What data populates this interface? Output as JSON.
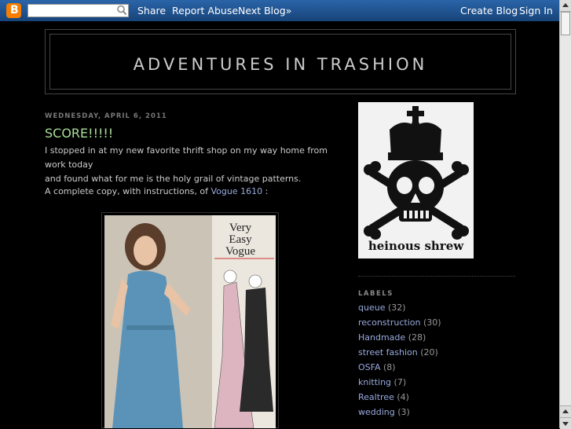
{
  "navbar": {
    "logo_letter": "B",
    "search_placeholder": "",
    "share": "Share",
    "report_abuse": "Report Abuse",
    "next_blog": "Next Blog»",
    "create_blog": "Create Blog",
    "sign_in": "Sign In",
    "bg_color": "#1f5795"
  },
  "header": {
    "title": "ADVENTURES IN TRASHION"
  },
  "post": {
    "date": "WEDNESDAY, APRIL 6, 2011",
    "title": "SCORE!!!!!",
    "paragraph_1_line_1": "I stopped in at my new favorite thrift shop on my way home from work today",
    "paragraph_1_line_2": "and found what for me is the holy grail of vintage patterns.",
    "paragraph_2_prefix": "A complete copy, with instructions, of ",
    "paragraph_2_link": "Vogue 1610",
    "paragraph_2_suffix": " :",
    "pattern_brand_line1": "Very",
    "pattern_brand_line2": "Easy",
    "pattern_brand_line3": "Vogue"
  },
  "sidebar": {
    "profile_caption": "heinous shrew",
    "labels_heading": "LABELS",
    "labels": [
      {
        "name": "queue",
        "count": "(32)"
      },
      {
        "name": "reconstruction",
        "count": "(30)"
      },
      {
        "name": "Handmade",
        "count": "(28)"
      },
      {
        "name": "street fashion",
        "count": "(20)"
      },
      {
        "name": "OSFA",
        "count": "(8)"
      },
      {
        "name": "knitting",
        "count": "(7)"
      },
      {
        "name": "Realtree",
        "count": "(4)"
      },
      {
        "name": "wedding",
        "count": "(3)"
      }
    ]
  },
  "colors": {
    "post_title": "#aadd99",
    "link": "#99aadd",
    "background": "#000000"
  }
}
